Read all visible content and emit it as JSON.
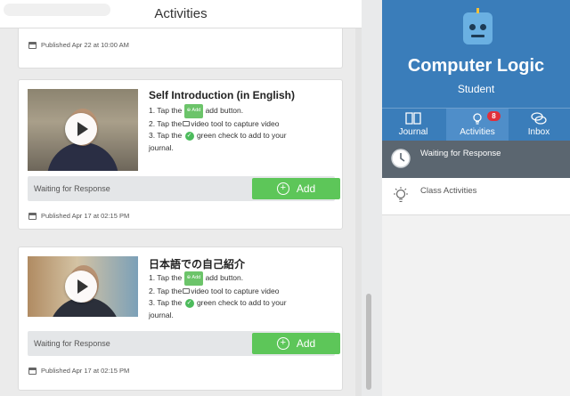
{
  "header": {
    "title": "Activities"
  },
  "cards": [
    {
      "published": "Published Apr 22 at 10:00 AM"
    },
    {
      "title": "Self Introduction (in English)",
      "steps": {
        "s1_pre": "1. Tap the",
        "s1_pill": "Add",
        "s1_post": "add button.",
        "s2_pre": "2. Tap the",
        "s2_post": "video tool to capture video",
        "s3_pre": "3. Tap the",
        "s3_post": "green check to add to your",
        "s3_cont": "journal."
      },
      "status": "Waiting for Response",
      "add_label": "Add",
      "published": "Published Apr 17 at 02:15 PM"
    },
    {
      "title": "日本語での自己紹介",
      "steps": {
        "s1_pre": "1. Tap the",
        "s1_pill": "Add",
        "s1_post": "add button.",
        "s2_pre": "2. Tap the",
        "s2_post": "video tool to capture video",
        "s3_pre": "3. Tap the",
        "s3_post": "green check to add to your",
        "s3_cont": "journal."
      },
      "status": "Waiting for Response",
      "add_label": "Add",
      "published": "Published Apr 17 at 02:15 PM"
    }
  ],
  "profile": {
    "name": "Computer Logic",
    "role": "Student"
  },
  "tabs": [
    {
      "label": "Journal",
      "icon": "book-icon"
    },
    {
      "label": "Activities",
      "icon": "lightbulb-icon",
      "badge": "8"
    },
    {
      "label": "Inbox",
      "icon": "chat-bubbles-icon"
    }
  ],
  "menu": [
    {
      "label": "Waiting for Response",
      "icon": "clock-icon"
    },
    {
      "label": "Class Activities",
      "icon": "lightbulb-icon"
    }
  ],
  "colors": {
    "header_blue": "#3a7dba",
    "add_green": "#5dc659",
    "badge_red": "#e0303a",
    "selected_gray": "#5b6670"
  }
}
